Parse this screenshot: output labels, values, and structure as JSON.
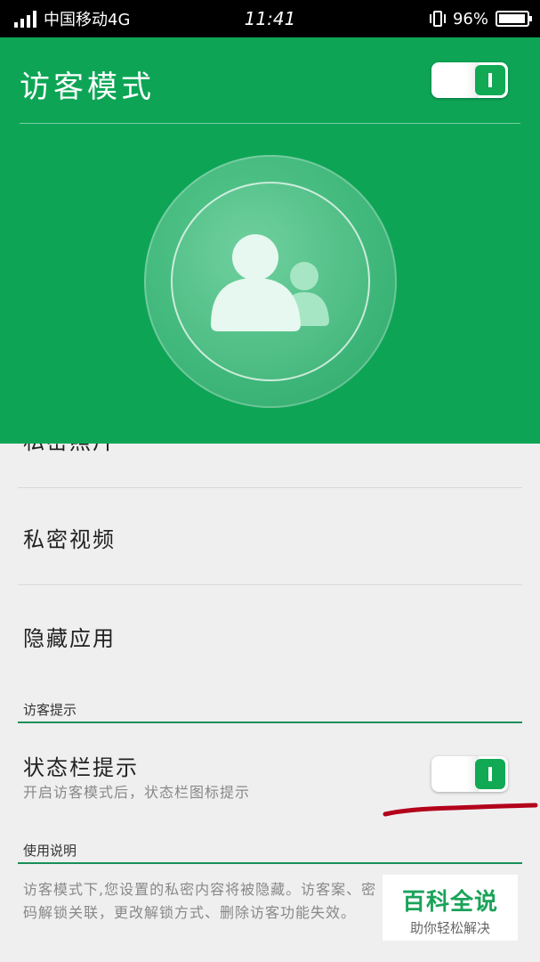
{
  "status_bar": {
    "carrier": "中国移动4G",
    "time": "11:41",
    "battery": "96%",
    "battery_level": 0.96
  },
  "header": {
    "title": "访客模式",
    "toggle_on": true
  },
  "list": {
    "partial_item": "私密照片",
    "items": [
      "私密视频",
      "隐藏应用"
    ]
  },
  "visitor_tip": {
    "section_label": "访客提示",
    "item_title": "状态栏提示",
    "item_subtitle": "开启访客模式后，状态栏图标提示",
    "toggle_on": true
  },
  "usage": {
    "section_label": "使用说明",
    "description": "访客模式下,您设置的私密内容将被隐藏。访客案、密码解锁关联，更改解锁方式、删除访客功能失效。"
  },
  "watermark": {
    "title": "百科全说",
    "subtitle": "助你轻松解决"
  },
  "colors": {
    "header_green": "#0da555",
    "accent": "#11a954",
    "annotation_red": "#b3001b"
  }
}
